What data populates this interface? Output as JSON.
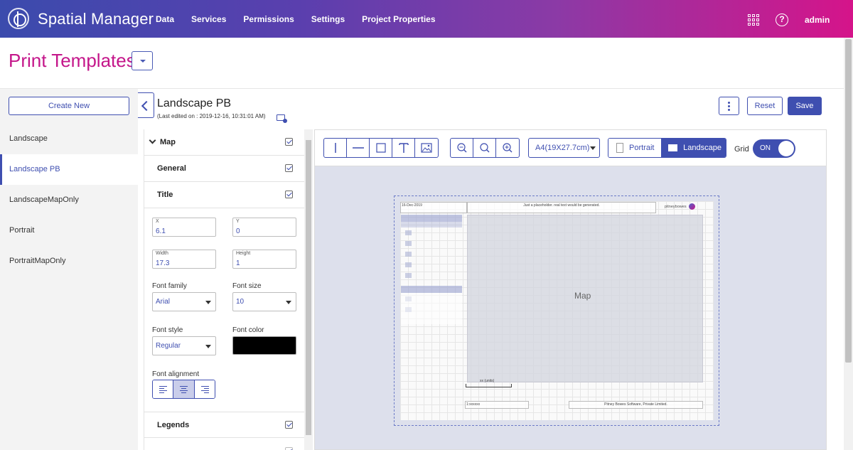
{
  "header": {
    "app_name": "Spatial Manager",
    "nav": [
      "Data",
      "Services",
      "Permissions",
      "Settings",
      "Project Properties"
    ],
    "user": "admin"
  },
  "page": {
    "title": "Print Templates"
  },
  "sidebar": {
    "create_label": "Create New",
    "items": [
      {
        "label": "Landscape",
        "active": false
      },
      {
        "label": "Landscape PB",
        "active": true
      },
      {
        "label": "LandscapeMapOnly",
        "active": false
      },
      {
        "label": "Portrait",
        "active": false
      },
      {
        "label": "PortraitMapOnly",
        "active": false
      }
    ]
  },
  "template": {
    "name": "Landscape PB",
    "edited": "(Last edited on : 2019-12-16, 10:31:01 AM)",
    "reset_label": "Reset",
    "save_label": "Save"
  },
  "properties": {
    "sections": {
      "map": "Map",
      "general": "General",
      "title": "Title",
      "legends": "Legends"
    },
    "x": {
      "label": "X",
      "value": "6.1"
    },
    "y": {
      "label": "Y",
      "value": "0"
    },
    "width": {
      "label": "Width",
      "value": "17.3"
    },
    "height": {
      "label": "Height",
      "value": "1"
    },
    "font_family": {
      "label": "Font family",
      "value": "Arial"
    },
    "font_size": {
      "label": "Font size",
      "value": "10"
    },
    "font_style": {
      "label": "Font style",
      "value": "Regular"
    },
    "font_color": {
      "label": "Font color",
      "value": "#000000"
    },
    "font_alignment": {
      "label": "Font alignment",
      "selected": "center"
    }
  },
  "toolbar": {
    "paper_size": "A4(19X27.7cm)",
    "portrait_label": "Portrait",
    "landscape_label": "Landscape",
    "orientation": "landscape",
    "grid_label": "Grid",
    "grid_state": "ON"
  },
  "preview": {
    "date": "16-Dec-2019",
    "title_placeholder": "Just a placeholder. real text would be generated.",
    "logo_text": "pitneybowes",
    "map_label": "Map",
    "units": "xx (units)",
    "scale": "1:xxxxxx",
    "copyright": "Pitney Bowes Software, Private Limited."
  },
  "colors": {
    "accent": "#3f4fb0",
    "title_pink": "#c4168a"
  }
}
